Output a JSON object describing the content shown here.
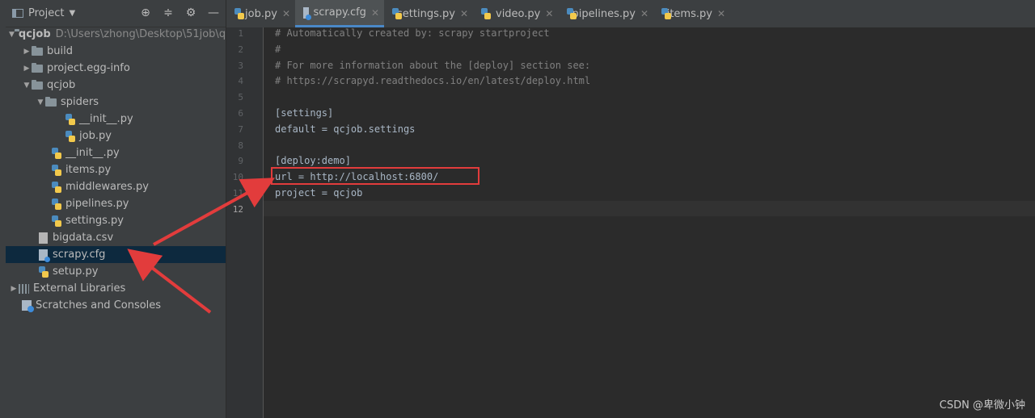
{
  "project_panel": {
    "title": "Project",
    "tree": [
      {
        "label": "qcjob",
        "path": "D:\\Users\\zhong\\Desktop\\51job\\qc",
        "kind": "folder",
        "expanded": true
      },
      {
        "label": "build",
        "kind": "folder",
        "expanded": false
      },
      {
        "label": "project.egg-info",
        "kind": "folder",
        "expanded": false
      },
      {
        "label": "qcjob",
        "kind": "folder",
        "expanded": true
      },
      {
        "label": "spiders",
        "kind": "folder",
        "expanded": true
      },
      {
        "label": "__init__.py",
        "kind": "py"
      },
      {
        "label": "job.py",
        "kind": "py"
      },
      {
        "label": "__init__.py",
        "kind": "py"
      },
      {
        "label": "items.py",
        "kind": "py"
      },
      {
        "label": "middlewares.py",
        "kind": "py"
      },
      {
        "label": "pipelines.py",
        "kind": "py"
      },
      {
        "label": "settings.py",
        "kind": "py"
      },
      {
        "label": "bigdata.csv",
        "kind": "csv"
      },
      {
        "label": "scrapy.cfg",
        "kind": "cfg",
        "selected": true
      },
      {
        "label": "setup.py",
        "kind": "py"
      },
      {
        "label": "External Libraries",
        "kind": "lib"
      },
      {
        "label": "Scratches and Consoles",
        "kind": "scratch"
      }
    ]
  },
  "tabs": [
    {
      "label": "job.py",
      "icon": "python-file-icon"
    },
    {
      "label": "scrapy.cfg",
      "icon": "config-file-icon",
      "active": true
    },
    {
      "label": "settings.py",
      "icon": "python-file-icon"
    },
    {
      "label": "video.py",
      "icon": "python-file-icon"
    },
    {
      "label": "pipelines.py",
      "icon": "python-file-icon"
    },
    {
      "label": "items.py",
      "icon": "python-file-icon"
    }
  ],
  "editor": {
    "lines": [
      "# Automatically created by: scrapy startproject",
      "#",
      "# For more information about the [deploy] section see:",
      "# https://scrapyd.readthedocs.io/en/latest/deploy.html",
      "",
      "[settings]",
      "default = qcjob.settings",
      "",
      "[deploy:demo]",
      "url = http://localhost:6800/",
      "project = qcjob",
      ""
    ],
    "line_numbers": [
      "1",
      "2",
      "3",
      "4",
      "5",
      "6",
      "7",
      "8",
      "9",
      "10",
      "11",
      "12"
    ],
    "current_line": "12"
  },
  "watermark": "CSDN @卑微小钟",
  "colors": {
    "accent": "#4a88c7",
    "annotation": "#e23c3c"
  }
}
